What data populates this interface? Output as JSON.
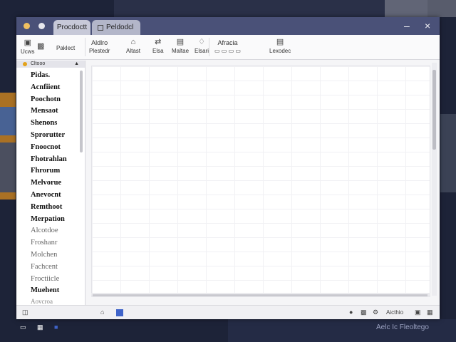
{
  "window": {
    "tabs": [
      {
        "label": "Procdoctt"
      },
      {
        "label": "Peldodcl"
      }
    ],
    "controls": {
      "minimize": "–",
      "close": "×"
    }
  },
  "toolbar": {
    "left": [
      {
        "icon": "disk-icon",
        "label": "Ucws"
      },
      {
        "icon": "image-icon",
        "label": ""
      },
      {
        "icon": "",
        "label": "Paklect"
      }
    ],
    "groups": [
      {
        "label": "Aldlro",
        "sub": "Plestedr"
      },
      {
        "label": "Altast",
        "icon": "home-icon"
      },
      {
        "label": "Elsa",
        "icon": "shuffle-icon"
      },
      {
        "label": "Maltae",
        "icon": "grid-icon"
      },
      {
        "label": "Elsari",
        "icon": "shield-icon"
      },
      {
        "label": "Afracia",
        "icon": "edit-icon"
      },
      {
        "label": "Lexodec",
        "icon": "stack-icon"
      }
    ]
  },
  "sidebar": {
    "header": "Cltooo",
    "items": [
      "Pidas.",
      "Acnfiient",
      "Poochotn",
      "Mensaot",
      "Shenons",
      "Sprorutter",
      "Fnoocnot",
      "Fhotrahlan",
      "Fhrorum",
      "Melvorue",
      "Anevocnt",
      "Remthoot",
      "Merpation",
      "Alcotdoe",
      "Froshanr",
      "Molchen",
      "Fachcent",
      "Froctiicle",
      "Muehent",
      "Aovcroa"
    ]
  },
  "statusbar": {
    "right_label": "Aicthio",
    "zoom_label": ""
  },
  "taskbar": {
    "brand": "Aelc Ic Fleoltego"
  }
}
